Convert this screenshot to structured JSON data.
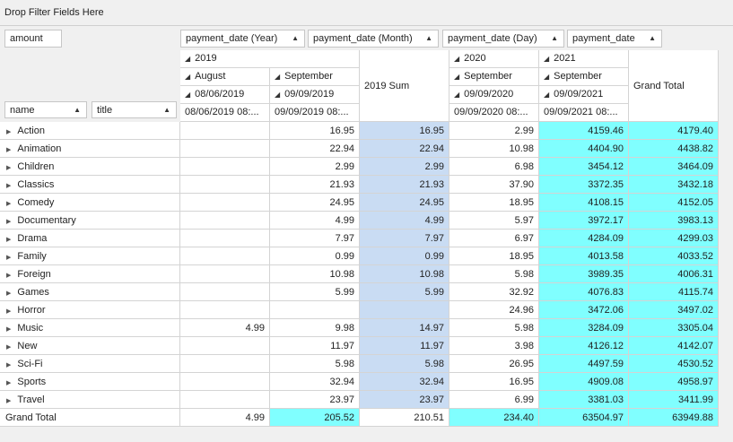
{
  "filter_area": {
    "label": "Drop Filter Fields Here"
  },
  "data_field": {
    "label": "amount"
  },
  "column_fields": [
    {
      "label": "payment_date (Year)"
    },
    {
      "label": "payment_date (Month)"
    },
    {
      "label": "payment_date (Day)"
    },
    {
      "label": "payment_date"
    }
  ],
  "row_fields": [
    {
      "label": "name"
    },
    {
      "label": "title"
    }
  ],
  "column_headers": {
    "years": [
      "2019",
      "2020",
      "2021"
    ],
    "months": [
      "August",
      "September",
      "September",
      "September"
    ],
    "days": [
      "08/06/2019",
      "09/09/2019",
      "09/09/2020",
      "09/09/2021"
    ],
    "dates": [
      "08/06/2019 08:...",
      "09/09/2019 08:...",
      "09/09/2020 08:...",
      "09/09/2021 08:..."
    ],
    "year_sum": "2019 Sum",
    "grand_total": "Grand Total"
  },
  "rows": [
    {
      "name": "Action",
      "values": [
        "",
        "16.95",
        "16.95",
        "2.99",
        "4159.46",
        "4179.40"
      ]
    },
    {
      "name": "Animation",
      "values": [
        "",
        "22.94",
        "22.94",
        "10.98",
        "4404.90",
        "4438.82"
      ]
    },
    {
      "name": "Children",
      "values": [
        "",
        "2.99",
        "2.99",
        "6.98",
        "3454.12",
        "3464.09"
      ]
    },
    {
      "name": "Classics",
      "values": [
        "",
        "21.93",
        "21.93",
        "37.90",
        "3372.35",
        "3432.18"
      ]
    },
    {
      "name": "Comedy",
      "values": [
        "",
        "24.95",
        "24.95",
        "18.95",
        "4108.15",
        "4152.05"
      ]
    },
    {
      "name": "Documentary",
      "values": [
        "",
        "4.99",
        "4.99",
        "5.97",
        "3972.17",
        "3983.13"
      ]
    },
    {
      "name": "Drama",
      "values": [
        "",
        "7.97",
        "7.97",
        "6.97",
        "4284.09",
        "4299.03"
      ]
    },
    {
      "name": "Family",
      "values": [
        "",
        "0.99",
        "0.99",
        "18.95",
        "4013.58",
        "4033.52"
      ]
    },
    {
      "name": "Foreign",
      "values": [
        "",
        "10.98",
        "10.98",
        "5.98",
        "3989.35",
        "4006.31"
      ]
    },
    {
      "name": "Games",
      "values": [
        "",
        "5.99",
        "5.99",
        "32.92",
        "4076.83",
        "4115.74"
      ]
    },
    {
      "name": "Horror",
      "values": [
        "",
        "",
        "",
        "24.96",
        "3472.06",
        "3497.02"
      ]
    },
    {
      "name": "Music",
      "values": [
        "4.99",
        "9.98",
        "14.97",
        "5.98",
        "3284.09",
        "3305.04"
      ]
    },
    {
      "name": "New",
      "values": [
        "",
        "11.97",
        "11.97",
        "3.98",
        "4126.12",
        "4142.07"
      ]
    },
    {
      "name": "Sci-Fi",
      "values": [
        "",
        "5.98",
        "5.98",
        "26.95",
        "4497.59",
        "4530.52"
      ]
    },
    {
      "name": "Sports",
      "values": [
        "",
        "32.94",
        "32.94",
        "16.95",
        "4909.08",
        "4958.97"
      ]
    },
    {
      "name": "Travel",
      "values": [
        "",
        "23.97",
        "23.97",
        "6.99",
        "3381.03",
        "3411.99"
      ]
    }
  ],
  "grand_total_row": {
    "label": "Grand Total",
    "values": [
      "4.99",
      "205.52",
      "210.51",
      "234.40",
      "63504.97",
      "63949.88"
    ]
  },
  "colors": {
    "year_sum_background": "#c9dcf3",
    "highlight_background": "#80ffff",
    "header_background": "#f0f0f0",
    "grid_line": "#d4d4d4"
  },
  "icons": {
    "sort": "sort-ascending-icon",
    "collapse": "collapse-icon",
    "expand_row": "expand-row-icon"
  }
}
